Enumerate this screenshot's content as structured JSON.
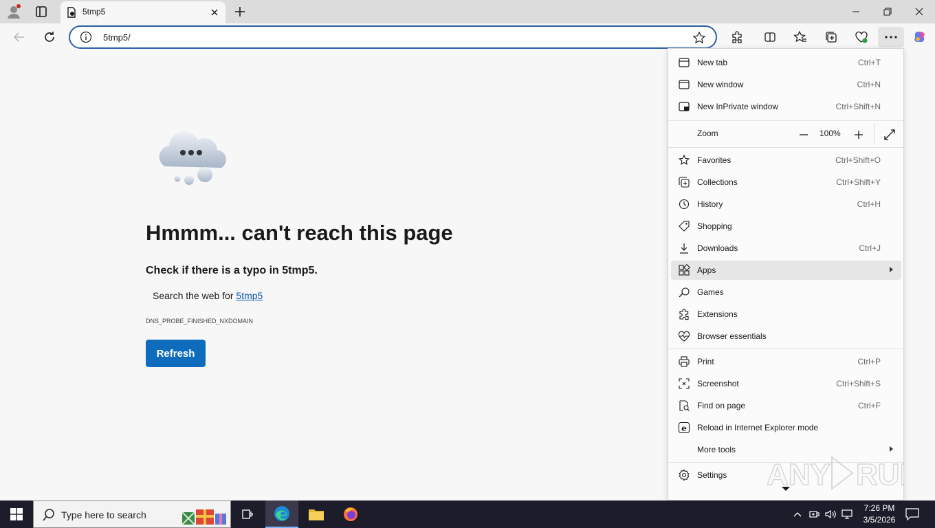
{
  "browser": {
    "tab": {
      "title": "5tmp5"
    },
    "address_bar": {
      "url": "5tmp5/"
    }
  },
  "page": {
    "title": "Hmmm... can't reach this page",
    "subtitle": "Check if there is a typo in 5tmp5.",
    "search_prefix": "Search the web for ",
    "search_link": "5tmp5",
    "error_code": "DNS_PROBE_FINISHED_NXDOMAIN",
    "refresh_label": "Refresh"
  },
  "menu": {
    "items": [
      {
        "label": "New tab",
        "shortcut": "Ctrl+T",
        "icon": "new-tab-icon"
      },
      {
        "label": "New window",
        "shortcut": "Ctrl+N",
        "icon": "new-window-icon"
      },
      {
        "label": "New InPrivate window",
        "shortcut": "Ctrl+Shift+N",
        "icon": "inprivate-icon"
      },
      {
        "label": "Favorites",
        "shortcut": "Ctrl+Shift+O",
        "icon": "star-icon"
      },
      {
        "label": "Collections",
        "shortcut": "Ctrl+Shift+Y",
        "icon": "collections-icon"
      },
      {
        "label": "History",
        "shortcut": "Ctrl+H",
        "icon": "history-icon"
      },
      {
        "label": "Shopping",
        "shortcut": "",
        "icon": "tag-icon"
      },
      {
        "label": "Downloads",
        "shortcut": "Ctrl+J",
        "icon": "download-icon"
      },
      {
        "label": "Apps",
        "shortcut": "",
        "icon": "apps-icon"
      },
      {
        "label": "Games",
        "shortcut": "",
        "icon": "games-icon"
      },
      {
        "label": "Extensions",
        "shortcut": "",
        "icon": "puzzle-icon"
      },
      {
        "label": "Browser essentials",
        "shortcut": "",
        "icon": "heart-pulse-icon"
      },
      {
        "label": "Print",
        "shortcut": "Ctrl+P",
        "icon": "printer-icon"
      },
      {
        "label": "Screenshot",
        "shortcut": "Ctrl+Shift+S",
        "icon": "screenshot-icon"
      },
      {
        "label": "Find on page",
        "shortcut": "Ctrl+F",
        "icon": "find-icon"
      },
      {
        "label": "Reload in Internet Explorer mode",
        "shortcut": "",
        "icon": "ie-icon"
      },
      {
        "label": "More tools",
        "shortcut": "",
        "icon": ""
      },
      {
        "label": "Settings",
        "shortcut": "",
        "icon": "gear-icon"
      }
    ],
    "zoom": {
      "label": "Zoom",
      "value": "100%"
    }
  },
  "taskbar": {
    "search_placeholder": "Type here to search",
    "time": "7:26 PM",
    "date": "3/5/2026"
  },
  "colors": {
    "accent": "#0f6cbd",
    "address_border": "#2a5ea8",
    "taskbar": "#1c1c2a"
  }
}
